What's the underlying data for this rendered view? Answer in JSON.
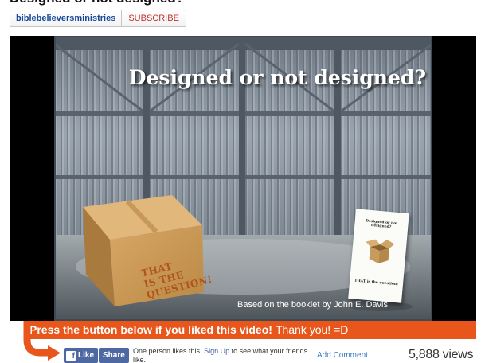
{
  "video": {
    "title": "Designed or not designed?",
    "channel_name": "biblebelieversministries",
    "subscribe_label": "SUBSCRIBE",
    "frame": {
      "title": "Designed or not designed?",
      "box_text": [
        "THAT",
        "IS THE",
        "QUESTION!"
      ],
      "booklet_title": "Designed or not designed?",
      "booklet_caption": "THAT is the question!",
      "credit": "Based on the booklet by John E. Davis"
    }
  },
  "banner": {
    "strong": "Press the button below if you liked this video!",
    "rest": "Thank you! =D",
    "color": "#e8561b"
  },
  "social": {
    "like_label": "Like",
    "fb_glyph": "f",
    "share_label": "Share",
    "likes_prefix": "One person likes this.",
    "signup_label": "Sign Up",
    "likes_suffix": "to see what your friends like.",
    "add_comment_label": "Add Comment"
  },
  "stats": {
    "views": "5,888 views"
  },
  "colors": {
    "facebook_blue": "#4e69a2",
    "youtube_red": "#c4302b",
    "link_blue": "#3b7bc7"
  },
  "icons": {
    "arrow": "curved-arrow-icon",
    "facebook": "facebook-icon"
  }
}
